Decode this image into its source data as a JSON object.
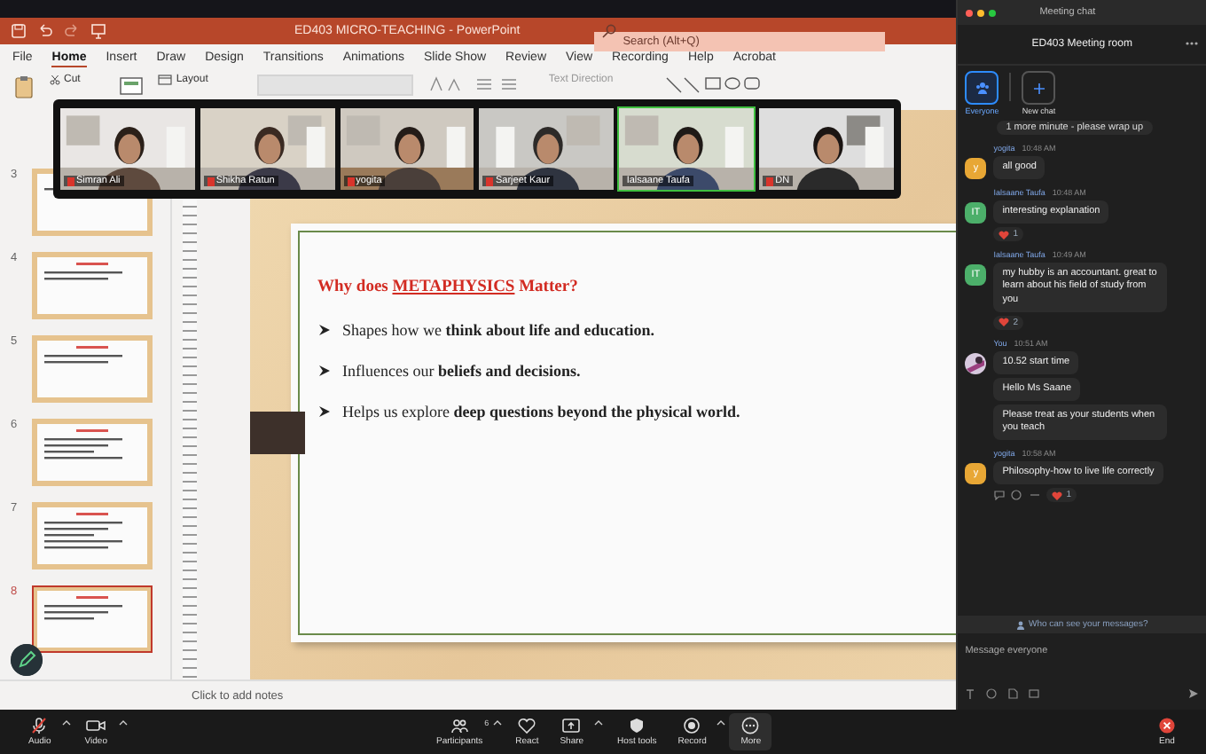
{
  "window": {
    "title": "ED403 MICRO-TEACHING  -  PowerPoint"
  },
  "search": {
    "placeholder": "Search (Alt+Q)"
  },
  "tabs": [
    {
      "label": "File",
      "selected": false
    },
    {
      "label": "Home",
      "selected": true
    },
    {
      "label": "Insert",
      "selected": false
    },
    {
      "label": "Draw",
      "selected": false
    },
    {
      "label": "Design",
      "selected": false
    },
    {
      "label": "Transitions",
      "selected": false
    },
    {
      "label": "Animations",
      "selected": false
    },
    {
      "label": "Slide Show",
      "selected": false
    },
    {
      "label": "Review",
      "selected": false
    },
    {
      "label": "View",
      "selected": false
    },
    {
      "label": "Recording",
      "selected": false
    },
    {
      "label": "Help",
      "selected": false
    },
    {
      "label": "Acrobat",
      "selected": false
    }
  ],
  "ribbon": {
    "cut": "Cut",
    "layout": "Layout",
    "text_direction": "Text Direction"
  },
  "video_tiles": [
    {
      "name": "Simran Ali",
      "active_speaker": false
    },
    {
      "name": "Shikha Ratun",
      "active_speaker": false
    },
    {
      "name": "yogita",
      "active_speaker": false
    },
    {
      "name": "Sarjeet Kaur",
      "active_speaker": false
    },
    {
      "name": "Ialsaane Taufa",
      "active_speaker": true
    },
    {
      "name": "DN",
      "active_speaker": false
    }
  ],
  "thumbnails": [
    {
      "number": "3",
      "selected": false
    },
    {
      "number": "4",
      "selected": false
    },
    {
      "number": "5",
      "selected": false
    },
    {
      "number": "6",
      "selected": false
    },
    {
      "number": "7",
      "selected": false
    },
    {
      "number": "8",
      "selected": true
    }
  ],
  "slide": {
    "title_start": "Why does",
    "title_keyword": "METAPHYSICS",
    "title_end": "Matter?",
    "bullets": [
      "Shapes how we **think about life and education.**",
      "Influences our **beliefs and decisions.**",
      "Helps us explore **deep questions beyond the physical world.**"
    ]
  },
  "notes": {
    "placeholder": "Click to add notes"
  },
  "chat": {
    "window_title": "Meeting chat",
    "room": "ED403 Meeting room",
    "tabs": [
      {
        "label": "Everyone",
        "selected": true
      },
      {
        "label": "New chat",
        "selected": false
      }
    ],
    "cut_message": "1 more minute - please wrap up",
    "groups": [
      {
        "sender": "yogita",
        "time": "10:48 AM",
        "avatar": "y",
        "color": "#e8a735",
        "messages": [
          "all good"
        ]
      },
      {
        "sender": "Ialsaane Taufa",
        "time": "10:48 AM",
        "avatar": "IT",
        "color": "#4caf6a",
        "messages": [
          "interesting explanation"
        ],
        "reaction": "1"
      },
      {
        "sender": "Ialsaane Taufa",
        "time": "10:49 AM",
        "avatar": "IT",
        "color": "#4caf6a",
        "messages": [
          "my hubby is an accountant. great to learn about his field of study from you"
        ],
        "reaction": "2"
      },
      {
        "sender": "You",
        "time": "10:51 AM",
        "kind": "picture",
        "messages": [
          "10.52 start time",
          "Hello Ms Saane",
          "Please treat as your students when you teach"
        ]
      },
      {
        "sender": "yogita",
        "time": "10:58 AM",
        "avatar": "y",
        "color": "#e8a735",
        "messages": [
          "Philosophy-how to live life correctly"
        ],
        "reaction": "1",
        "actions": true
      }
    ],
    "privacy": "Who can see your messages?",
    "input": {
      "placeholder": "Message everyone"
    }
  },
  "toolbar": [
    {
      "kind": "audio",
      "label": "Audio",
      "muted": true
    },
    {
      "kind": "video",
      "label": "Video"
    },
    {
      "kind": "participants",
      "label": "Participants",
      "count": "6"
    },
    {
      "kind": "react",
      "label": "React"
    },
    {
      "kind": "share",
      "label": "Share"
    },
    {
      "kind": "host",
      "label": "Host tools"
    },
    {
      "kind": "record",
      "label": "Record"
    },
    {
      "kind": "more",
      "label": "More",
      "selected": true
    },
    {
      "kind": "end",
      "label": "End"
    }
  ]
}
